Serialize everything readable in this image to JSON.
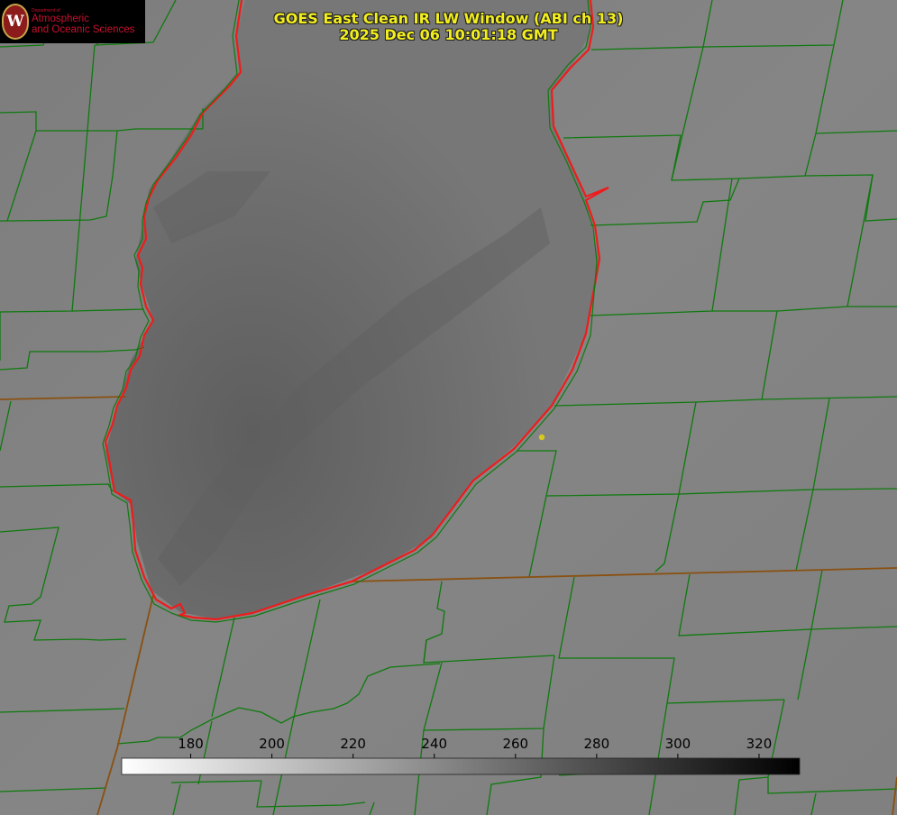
{
  "title": {
    "line1": "GOES East Clean IR LW Window (ABI ch 13)",
    "line2": "2025 Dec 06 10:01:18 GMT"
  },
  "logo": {
    "dept": "Department of",
    "line1": "Atmospheric",
    "line2": "and Oceanic Sciences",
    "seal_letter": "W",
    "icon": "uw-seal-icon"
  },
  "colorbar": {
    "ticks": [
      "180",
      "200",
      "220",
      "240",
      "260",
      "280",
      "300",
      "320"
    ],
    "tick_values": [
      180,
      200,
      220,
      240,
      260,
      280,
      300,
      320
    ],
    "range": [
      163,
      330
    ],
    "gradient": "white-to-black"
  },
  "colors": {
    "title": "#f2ee1e",
    "county_lines": "#0e7a0e",
    "coastline": "#ee1c1c",
    "state_lines": "#8a5010",
    "marker": "#d8c81e",
    "land": "#828282",
    "lake": "#737373"
  }
}
